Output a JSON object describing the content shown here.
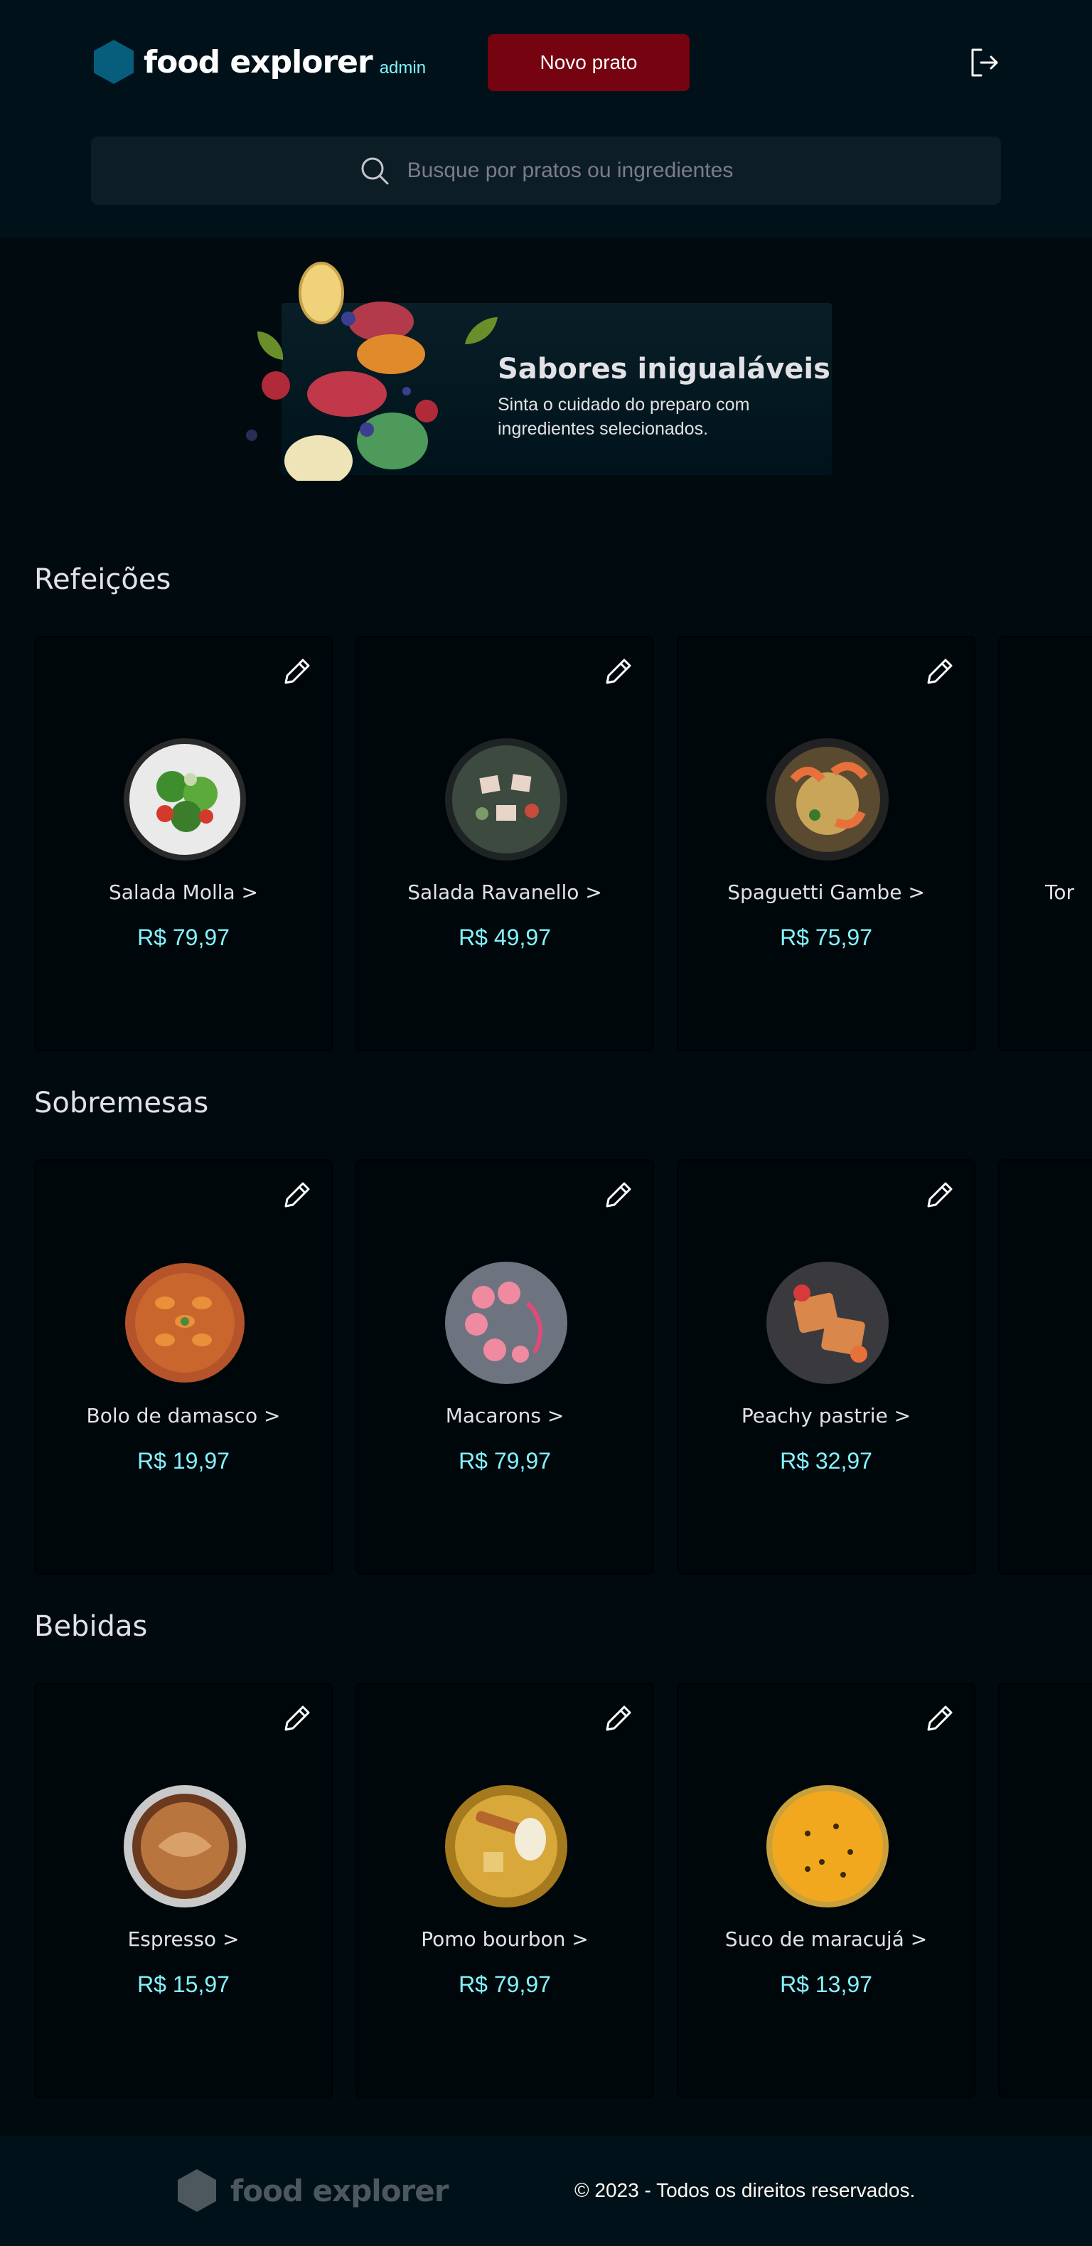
{
  "header": {
    "brand": "food explorer",
    "role_badge": "admin",
    "new_dish_label": "Novo prato",
    "logout_icon": "sign-out-icon",
    "search_placeholder": "Busque por pratos ou ingredientes",
    "search_icon": "search-icon"
  },
  "banner": {
    "title": "Sabores inigualáveis",
    "subtitle": "Sinta o cuidado do preparo com ingredientes selecionados."
  },
  "sections": [
    {
      "title": "Refeições",
      "items": [
        {
          "name": "Salada Molla >",
          "price": "R$ 79,97",
          "image": "salad-molla"
        },
        {
          "name": "Salada Ravanello >",
          "price": "R$ 49,97",
          "image": "salad-ravanello"
        },
        {
          "name": "Spaguetti Gambe >",
          "price": "R$ 75,97",
          "image": "spaghetti-shrimp"
        },
        {
          "name": "Tor",
          "price": "",
          "image": ""
        }
      ]
    },
    {
      "title": "Sobremesas",
      "items": [
        {
          "name": "Bolo de damasco >",
          "price": "R$ 19,97",
          "image": "apricot-cake"
        },
        {
          "name": "Macarons >",
          "price": "R$ 79,97",
          "image": "macarons"
        },
        {
          "name": "Peachy pastrie >",
          "price": "R$ 32,97",
          "image": "peach-pastry"
        },
        {
          "name": "",
          "price": "",
          "image": ""
        }
      ]
    },
    {
      "title": "Bebidas",
      "items": [
        {
          "name": "Espresso >",
          "price": "R$ 15,97",
          "image": "espresso"
        },
        {
          "name": "Pomo bourbon >",
          "price": "R$ 79,97",
          "image": "pomo-bourbon"
        },
        {
          "name": "Suco de maracujá >",
          "price": "R$ 13,97",
          "image": "passion-fruit-juice"
        },
        {
          "name": "",
          "price": "",
          "image": ""
        }
      ]
    }
  ],
  "footer": {
    "brand": "food explorer",
    "copyright": "© 2023 - Todos os direitos reservados."
  },
  "colors": {
    "accent": "#82F3FF",
    "button": "#750310",
    "header_bg": "#00111a",
    "page_bg": "#000a0f"
  }
}
